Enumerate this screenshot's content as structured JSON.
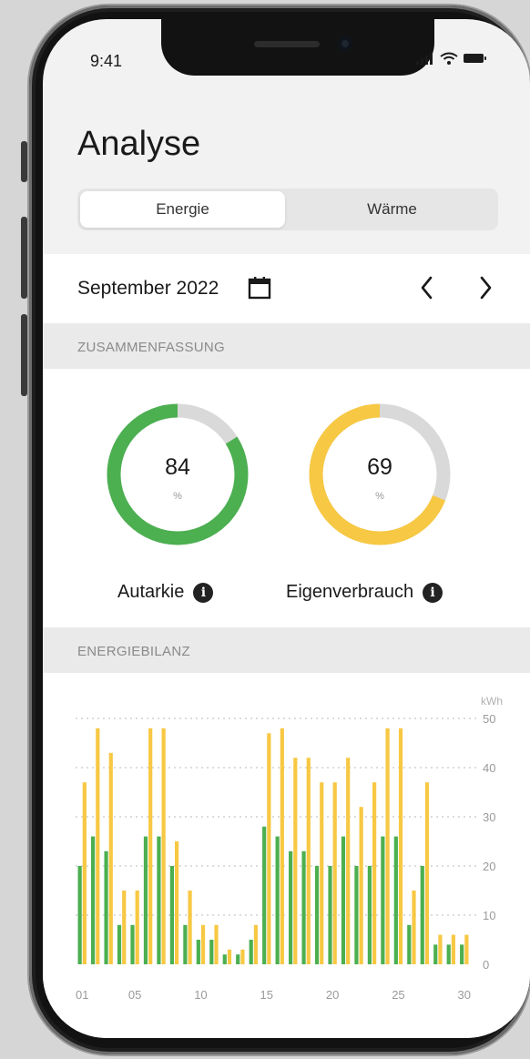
{
  "status_bar": {
    "time": "9:41"
  },
  "header": {
    "title": "Analyse"
  },
  "tabs": [
    {
      "label": "Energie",
      "active": true
    },
    {
      "label": "Wärme",
      "active": false
    }
  ],
  "period": {
    "label": "September 2022"
  },
  "summary": {
    "section_title": "ZUSAMMENFASSUNG",
    "gauges": [
      {
        "value": "84",
        "unit": "%",
        "label": "Autarkie",
        "percent": 84,
        "color": "#4caf50"
      },
      {
        "value": "69",
        "unit": "%",
        "label": "Eigenverbrauch",
        "percent": 69,
        "color": "#f7c843"
      }
    ]
  },
  "energy_balance": {
    "section_title": "ENERGIEBILANZ"
  },
  "colors": {
    "green": "#4caf50",
    "yellow": "#f7c843",
    "track": "#d9d9d9"
  },
  "chart_data": {
    "type": "bar",
    "ylabel": "kWh",
    "ylim": [
      0,
      50
    ],
    "y_ticks": [
      "0",
      "10",
      "20",
      "30",
      "40",
      "50"
    ],
    "x_tick_labels": [
      "01",
      "05",
      "10",
      "15",
      "20",
      "25",
      "30"
    ],
    "grid": true,
    "categories": [
      1,
      2,
      3,
      4,
      5,
      6,
      7,
      8,
      9,
      10,
      11,
      12,
      13,
      14,
      15,
      16,
      17,
      18,
      19,
      20,
      21,
      22,
      23,
      24,
      25,
      26,
      27,
      28,
      29,
      30
    ],
    "series": [
      {
        "color": "#4caf50",
        "values": [
          20,
          26,
          23,
          8,
          8,
          26,
          26,
          20,
          8,
          5,
          5,
          2,
          2,
          5,
          28,
          26,
          23,
          23,
          20,
          20,
          26,
          20,
          20,
          26,
          26,
          8,
          20,
          4,
          4,
          4
        ]
      },
      {
        "color": "#f7c843",
        "values": [
          37,
          48,
          43,
          15,
          15,
          48,
          48,
          25,
          15,
          8,
          8,
          3,
          3,
          8,
          47,
          48,
          42,
          42,
          37,
          37,
          42,
          32,
          37,
          48,
          48,
          15,
          37,
          6,
          6,
          6
        ]
      }
    ]
  }
}
